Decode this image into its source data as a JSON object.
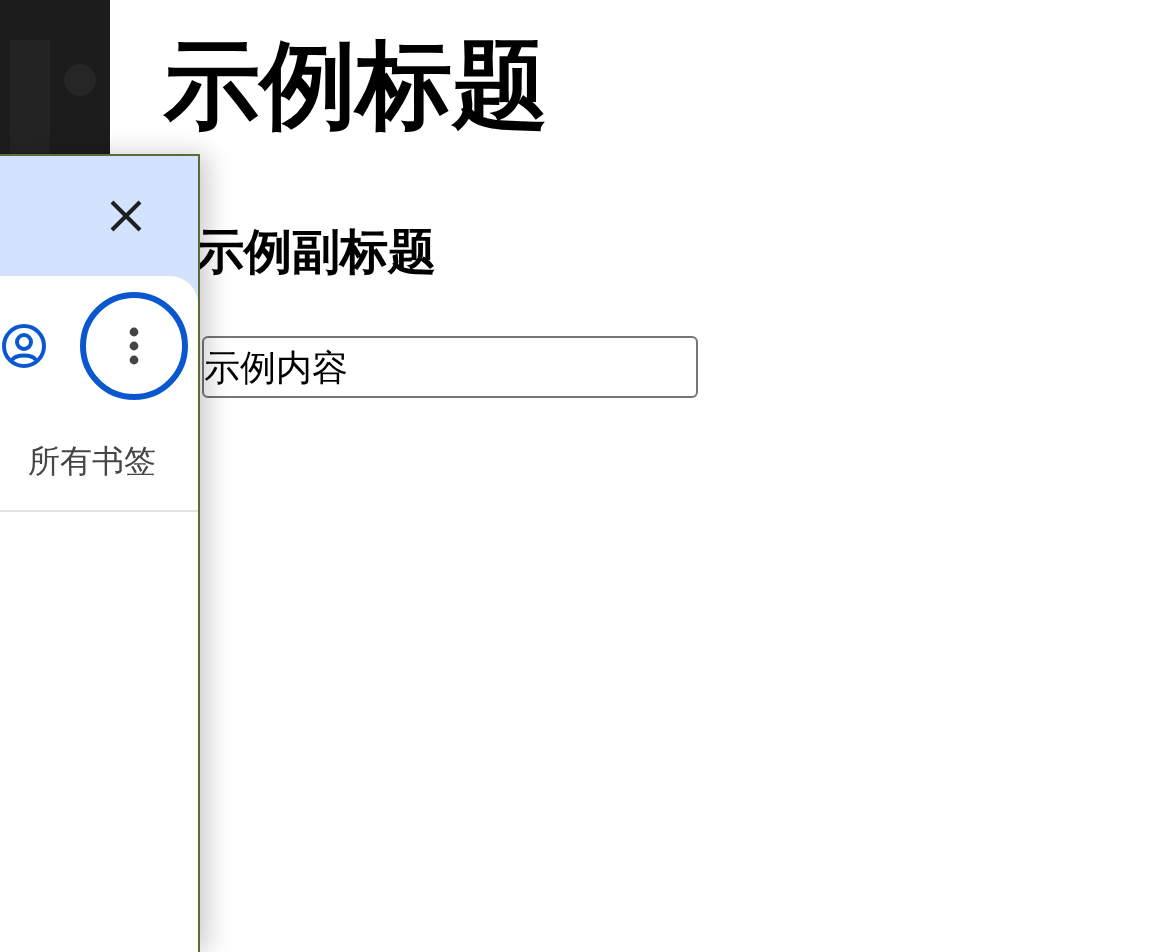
{
  "page": {
    "title": "示例标题",
    "subtitle": "示例副标题",
    "input": {
      "value": "示例内容"
    }
  },
  "panel": {
    "more_button": {
      "focused": true
    },
    "label": "所有书签"
  }
}
